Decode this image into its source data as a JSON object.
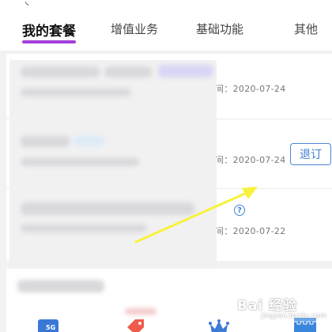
{
  "tabs": {
    "items": [
      {
        "label": "我的套餐",
        "active": true
      },
      {
        "label": "增值业务",
        "active": false
      },
      {
        "label": "基础功能",
        "active": false
      },
      {
        "label": "其他",
        "active": false
      }
    ]
  },
  "packages": [
    {
      "time_fragment": "间：2020-07-24"
    },
    {
      "time_fragment": "间：2020-07-24",
      "action_label": "退订"
    },
    {
      "time_fragment": "间：2020-07-22"
    }
  ],
  "help_glyph": "?",
  "bottom_nav": {
    "phone_icon_text": "5G"
  },
  "watermark": {
    "text": "Bai 经验",
    "url": "jingyan.baidu.com"
  },
  "colors": {
    "accent_underline": "#a33fd8",
    "link_blue": "#3e7cd0",
    "arrow_yellow": "#f7f23a"
  },
  "icons": [
    "sim-card-icon",
    "tag-icon",
    "crown-icon",
    "store-icon",
    "help-icon"
  ]
}
